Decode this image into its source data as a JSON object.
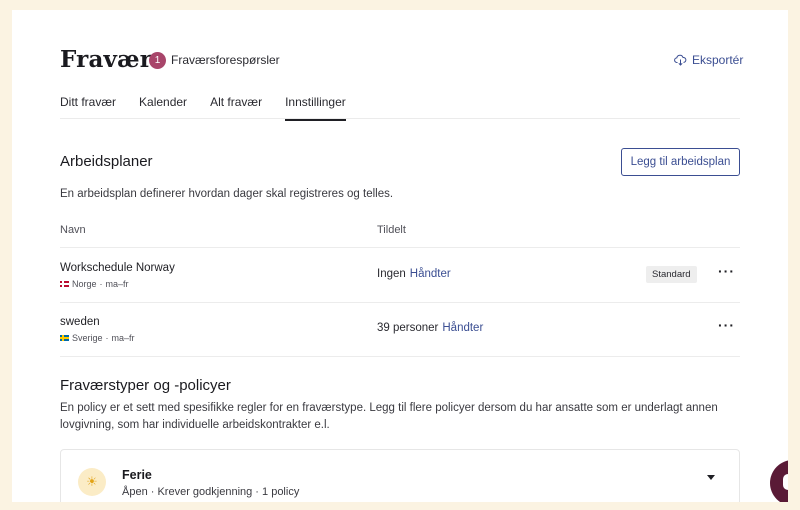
{
  "header": {
    "title": "Fravær",
    "badge_count": "1",
    "badge_label": "Fraværsforespørsler",
    "export_label": "Eksportér"
  },
  "tabs": [
    {
      "label": "Ditt fravær",
      "active": false
    },
    {
      "label": "Kalender",
      "active": false
    },
    {
      "label": "Alt fravær",
      "active": false
    },
    {
      "label": "Innstillinger",
      "active": true
    }
  ],
  "work_schedules": {
    "title": "Arbeidsplaner",
    "add_button": "Legg til arbeidsplan",
    "description": "En arbeidsplan definerer hvordan dager skal registreres og telles.",
    "columns": {
      "name": "Navn",
      "assigned": "Tildelt"
    },
    "rows": [
      {
        "name": "Workschedule Norway",
        "country": "Norge",
        "days": "ma–fr",
        "assigned": "Ingen",
        "manage": "Håndter",
        "tag": "Standard"
      },
      {
        "name": "sweden",
        "country": "Sverige",
        "days": "ma–fr",
        "assigned": "39 personer",
        "manage": "Håndter",
        "tag": ""
      }
    ]
  },
  "policies": {
    "title": "Fraværstyper og -policyer",
    "description": "En policy er et sett med spesifikke regler for en fraværstype. Legg til flere policyer dersom du har ansatte som er underlagt annen lovgivning, som har individuelle arbeidskontrakter e.l.",
    "cards": [
      {
        "title": "Ferie",
        "subtitle": "Åpen · Krever godkjenning · 1 policy",
        "icon": "sun-icon"
      }
    ]
  },
  "colors": {
    "accent": "#3b4e92",
    "badge": "#a8456a",
    "background": "#fbf3e2",
    "chat": "#5a1a36"
  }
}
